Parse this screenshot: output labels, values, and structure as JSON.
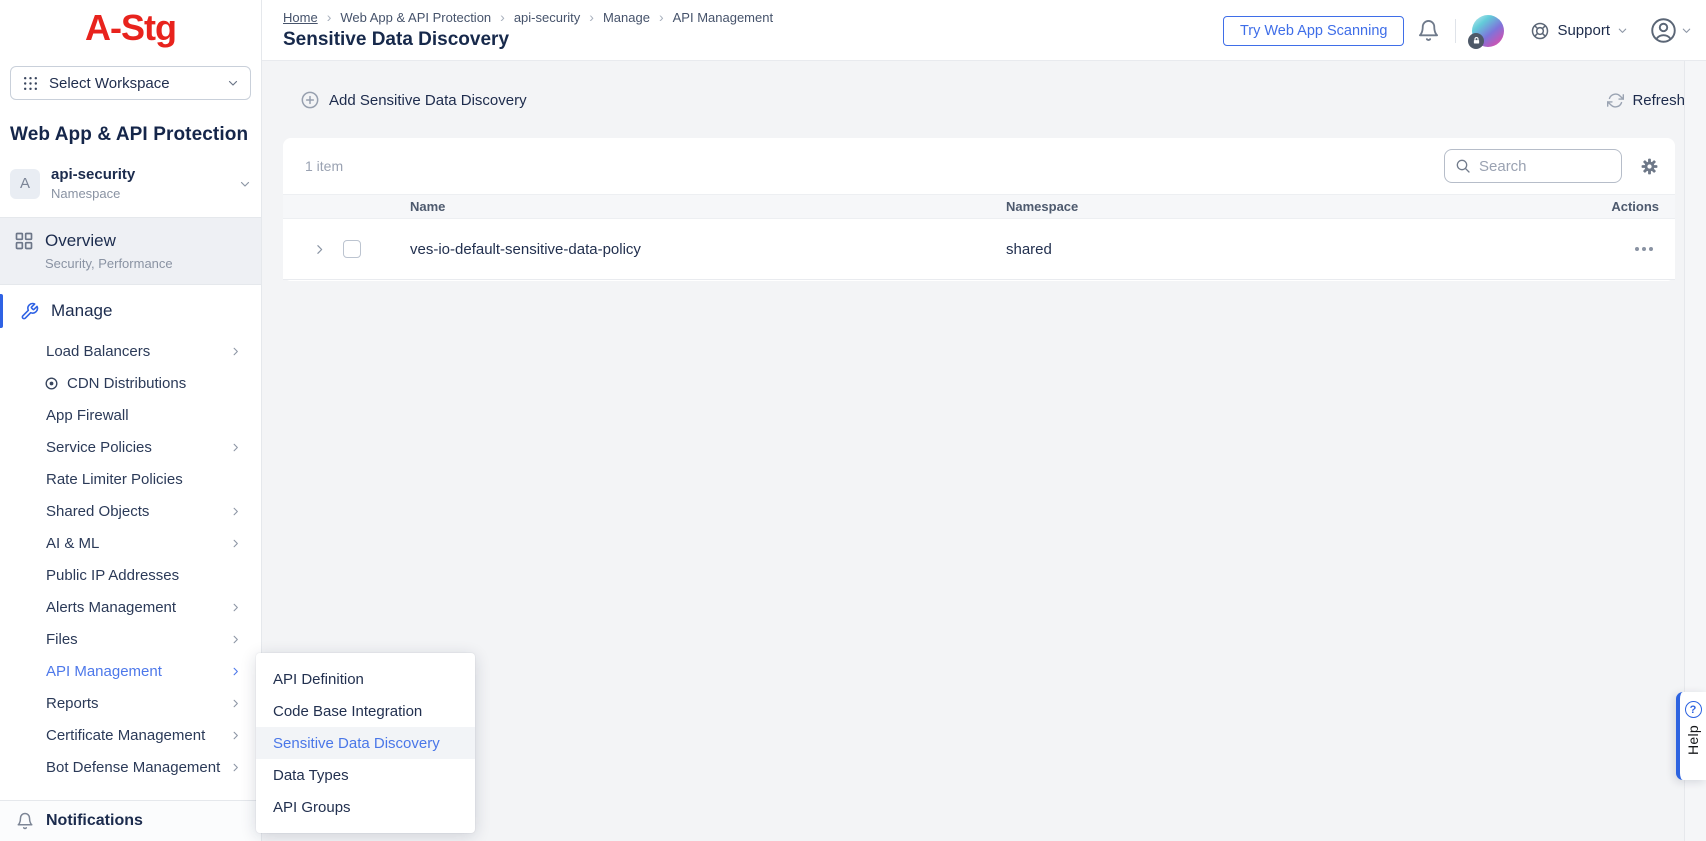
{
  "colors": {
    "brand_red": "#e8231d",
    "accent_blue": "#3f6ee8",
    "link_blue": "#4d78ea"
  },
  "brand": {
    "logo": "A-Stg"
  },
  "workspace": {
    "selector_label": "Select Workspace"
  },
  "sidebar": {
    "title": "Web App & API Protection",
    "namespace": {
      "initial": "A",
      "name": "api-security",
      "label": "Namespace"
    },
    "overview": {
      "label": "Overview",
      "subtitle": "Security, Performance"
    },
    "manage_label": "Manage",
    "items": [
      {
        "label": "Load Balancers"
      },
      {
        "label": "CDN Distributions"
      },
      {
        "label": "App Firewall"
      },
      {
        "label": "Service Policies"
      },
      {
        "label": "Rate Limiter Policies"
      },
      {
        "label": "Shared Objects"
      },
      {
        "label": "AI & ML"
      },
      {
        "label": "Public IP Addresses"
      },
      {
        "label": "Alerts Management"
      },
      {
        "label": "Files"
      },
      {
        "label": "API Management"
      },
      {
        "label": "Reports"
      },
      {
        "label": "Certificate Management"
      },
      {
        "label": "Bot Defense Management"
      }
    ],
    "notifications_label": "Notifications"
  },
  "header": {
    "breadcrumb": [
      "Home",
      "Web App & API Protection",
      "api-security",
      "Manage",
      "API Management"
    ],
    "page_title": "Sensitive Data Discovery",
    "try_scanning_label": "Try Web App Scanning",
    "support_label": "Support"
  },
  "toolbar": {
    "add_label": "Add Sensitive Data Discovery",
    "refresh_label": "Refresh"
  },
  "table": {
    "count_label": "1 item",
    "search_placeholder": "Search",
    "columns": [
      "Name",
      "Namespace",
      "Actions"
    ],
    "rows": [
      {
        "name": "ves-io-default-sensitive-data-policy",
        "namespace": "shared"
      }
    ]
  },
  "flyout": {
    "items": [
      {
        "label": "API Definition"
      },
      {
        "label": "Code Base Integration"
      },
      {
        "label": "Sensitive Data Discovery"
      },
      {
        "label": "Data Types"
      },
      {
        "label": "API Groups"
      }
    ]
  },
  "help": {
    "label": "Help"
  }
}
